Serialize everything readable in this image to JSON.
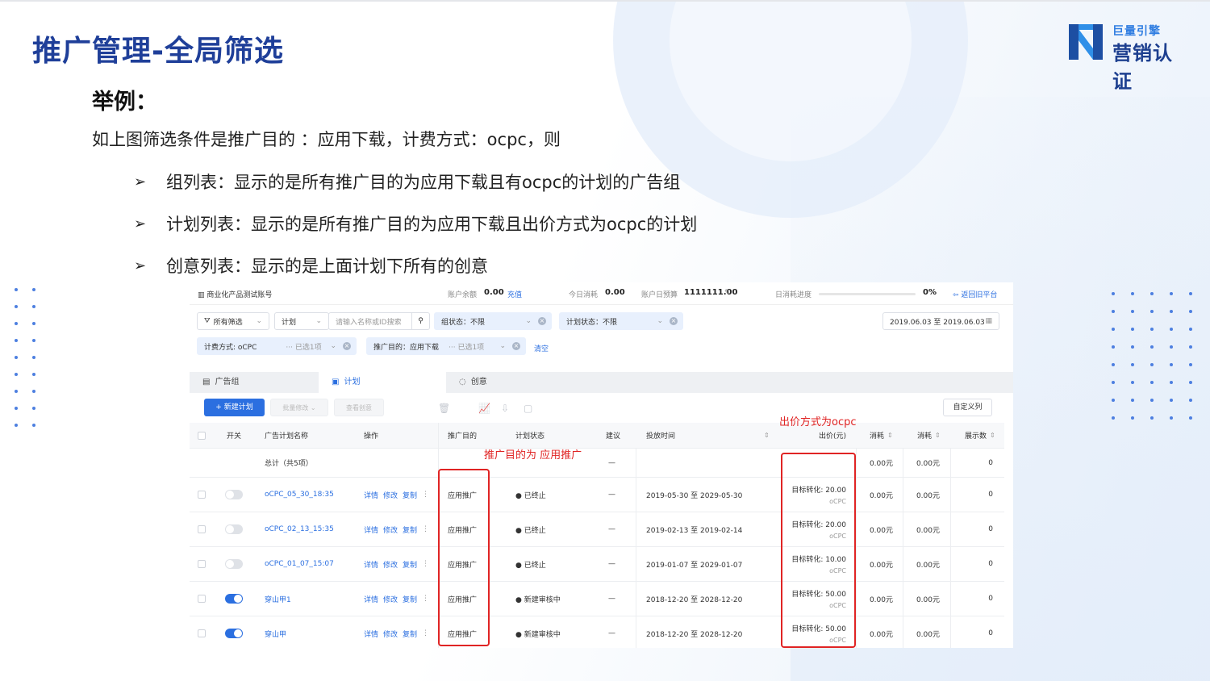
{
  "slide": {
    "title": "推广管理-全局筛选",
    "example_heading": "举例：",
    "lead": "如上图筛选条件是推广目的 ：应用下载，计费方式：ocpc，则",
    "bullets": [
      "组列表：显示的是所有推广目的为应用下载且有ocpc的计划的广告组",
      "计划列表：显示的是所有推广目的为应用下载且出价方式为ocpc的计划",
      "创意列表：显示的是上面计划下所有的创意"
    ],
    "bullet_icon": "arrowhead-bullet",
    "logo": {
      "top": "巨量引擎",
      "bottom": "营销认证"
    }
  },
  "account_bar": {
    "account_name": "商业化产品测试账号",
    "balance_label": "账户余额",
    "balance_value": "0.00",
    "recharge": "充值",
    "today_cost_label": "今日消耗",
    "today_cost_value": "0.00",
    "daily_budget_label": "账户日预算",
    "daily_budget_value": "1111111.00",
    "daily_progress_label": "日消耗进度",
    "daily_progress_value": "0%",
    "back_old": "返回旧平台"
  },
  "filters": {
    "all_filters": "所有筛选",
    "plan_select": "计划",
    "search_placeholder": "请输入名称或ID搜索",
    "group_status": "组状态：不限",
    "plan_status": "计划状态：不限",
    "date_range": "2019.06.03 至 2019.06.03",
    "billing": "计费方式: oCPC",
    "billing_selected": "··· 已选1项",
    "purpose": "推广目的：应用下载",
    "purpose_selected": "··· 已选1项",
    "clear": "清空"
  },
  "tabs": [
    {
      "label": "广告组",
      "icon": "group-icon"
    },
    {
      "label": "计划",
      "icon": "plan-icon"
    },
    {
      "label": "创意",
      "icon": "idea-icon"
    }
  ],
  "toolbar": {
    "new_plan": "+ 新建计划",
    "batch_edit": "批量修改 ⌄",
    "view_creative": "查看创意",
    "custom_columns": "自定义列"
  },
  "table": {
    "headers": [
      "开关",
      "广告计划名称",
      "操作",
      "推广目的",
      "计划状态",
      "建议",
      "投放时间",
      "出价(元)",
      "消耗",
      "消耗",
      "展示数"
    ],
    "total_label": "总计（共5项）",
    "total_row": {
      "suggest": "—",
      "cost1": "0.00元",
      "cost2": "0.00元",
      "impr": "0"
    },
    "actions": [
      "详情",
      "修改",
      "复制"
    ],
    "rows": [
      {
        "on": false,
        "name": "oCPC_05_30_18:35",
        "purpose": "应用推广",
        "status": "● 已终止",
        "suggest": "—",
        "period": "2019-05-30 至 2029-05-30",
        "bid": "目标转化: 20.00",
        "bid_type": "oCPC",
        "cost1": "0.00元",
        "cost2": "0.00元",
        "impr": "0"
      },
      {
        "on": false,
        "name": "oCPC_02_13_15:35",
        "purpose": "应用推广",
        "status": "● 已终止",
        "suggest": "—",
        "period": "2019-02-13 至 2019-02-14",
        "bid": "目标转化: 20.00",
        "bid_type": "oCPC",
        "cost1": "0.00元",
        "cost2": "0.00元",
        "impr": "0"
      },
      {
        "on": false,
        "name": "oCPC_01_07_15:07",
        "purpose": "应用推广",
        "status": "● 已终止",
        "suggest": "—",
        "period": "2019-01-07 至 2029-01-07",
        "bid": "目标转化: 10.00",
        "bid_type": "oCPC",
        "cost1": "0.00元",
        "cost2": "0.00元",
        "impr": "0"
      },
      {
        "on": true,
        "name": "穿山甲1",
        "purpose": "应用推广",
        "status": "● 新建审核中",
        "suggest": "—",
        "period": "2018-12-20 至 2028-12-20",
        "bid": "目标转化: 50.00",
        "bid_type": "oCPC",
        "cost1": "0.00元",
        "cost2": "0.00元",
        "impr": "0"
      },
      {
        "on": true,
        "name": "穿山甲",
        "purpose": "应用推广",
        "status": "● 新建审核中",
        "suggest": "—",
        "period": "2018-12-20 至 2028-12-20",
        "bid": "目标转化: 50.00",
        "bid_type": "oCPC",
        "cost1": "0.00元",
        "cost2": "0.00元",
        "impr": "0"
      }
    ]
  },
  "annotations": {
    "bid_note": "出价方式为ocpc",
    "purpose_note": "推广目的为 应用推广"
  },
  "colors": {
    "title": "#1f3f99",
    "accent": "#2b6fe0",
    "highlight": "#e02424"
  }
}
